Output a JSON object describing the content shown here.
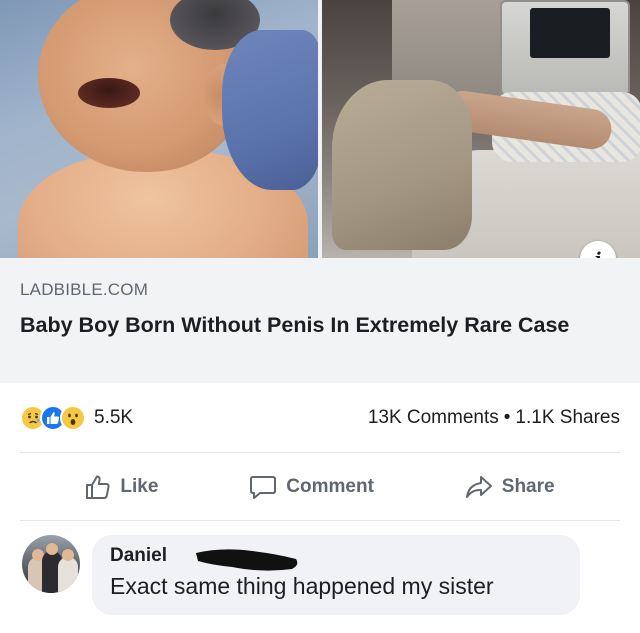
{
  "link": {
    "domain": "LADBIBLE.COM",
    "title": "Baby Boy Born Without Penis In Extremely Rare Case"
  },
  "images": {
    "left": "newborn-baby-photo",
    "right": "hospital-bed-photo"
  },
  "info_icon": "i",
  "reactions": {
    "icons": [
      "sad-reaction-icon",
      "like-reaction-icon",
      "wow-reaction-icon"
    ],
    "count": "5.5K",
    "comments": "13K Comments",
    "separator": "•",
    "shares": "1.1K Shares"
  },
  "actions": {
    "like": "Like",
    "comment": "Comment",
    "share": "Share"
  },
  "comment": {
    "author": "Daniel",
    "text": "Exact same thing happened my sister"
  },
  "colors": {
    "facebook_blue": "#1877f2",
    "text": "#1c1e21",
    "secondary_text": "#606770",
    "caption_bg": "#f2f3f5",
    "bubble_bg": "#f0f2f5"
  }
}
